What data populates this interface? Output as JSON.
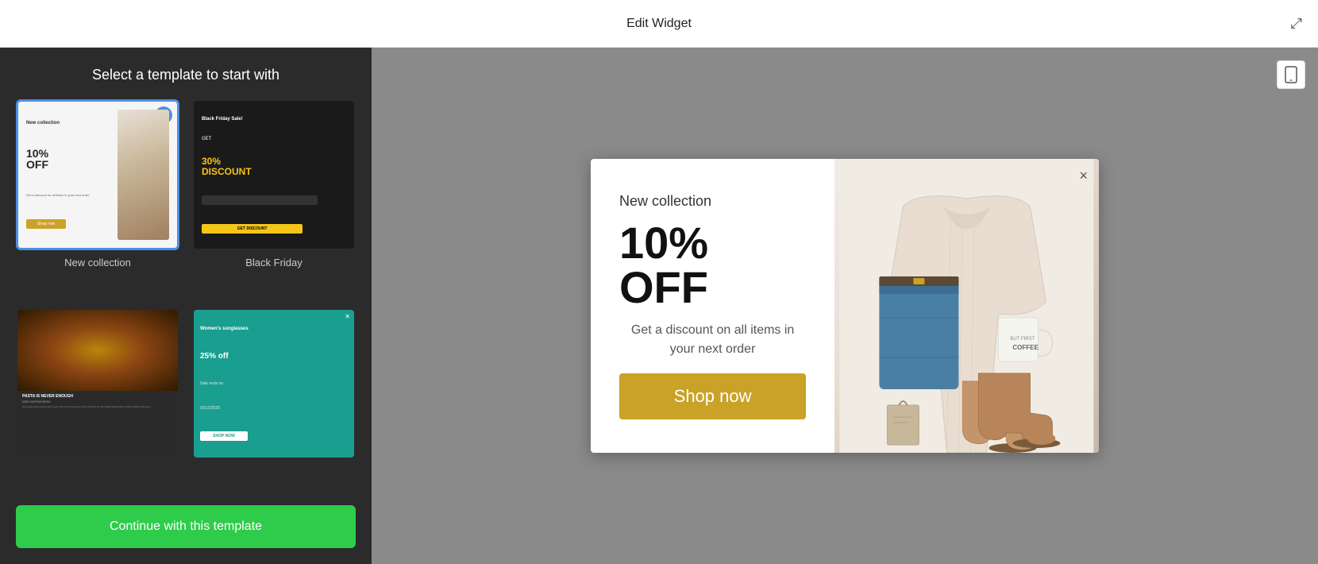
{
  "header": {
    "title": "Edit Widget",
    "expand_icon": "⤢"
  },
  "left_panel": {
    "title": "Select a template to start with",
    "templates": [
      {
        "id": "new-collection",
        "label": "New collection",
        "selected": true,
        "thumb_type": "new-collection"
      },
      {
        "id": "black-friday",
        "label": "Black Friday",
        "selected": false,
        "thumb_type": "black-friday"
      },
      {
        "id": "pasta",
        "label": "",
        "selected": false,
        "thumb_type": "pasta"
      },
      {
        "id": "sunglasses",
        "label": "",
        "selected": false,
        "thumb_type": "sunglasses"
      }
    ],
    "continue_button": "Continue with this template"
  },
  "preview": {
    "widget": {
      "collection_label": "New collection",
      "discount_label": "10% OFF",
      "description": "Get a discount on all items in your next order",
      "shop_button": "Shop now",
      "close_button": "×"
    }
  },
  "mobile_icon": "📱"
}
